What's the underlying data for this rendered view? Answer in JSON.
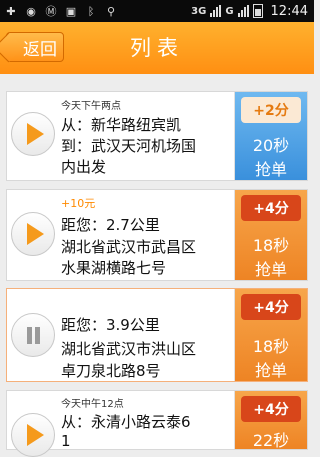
{
  "status_bar": {
    "icons": [
      "add-icon",
      "location-icon",
      "app-icon-m",
      "app-icon-square",
      "bluetooth-icon",
      "usb-icon"
    ],
    "network_1": "3G",
    "network_2": "G",
    "time": "12:44"
  },
  "header": {
    "back_label": "返回",
    "title": "列表"
  },
  "items": [
    {
      "top_text": "今天下午两点",
      "bonus_text": "",
      "lines": [
        "从：新华路纽宾凯",
        "到：武汉天河机场国",
        "内出发"
      ],
      "badge": "+2分",
      "seconds": "20秒",
      "action": "抢单",
      "style": "blue",
      "state": "play"
    },
    {
      "top_text": "",
      "bonus_text": "+10元",
      "lines": [
        "距您：2.7公里",
        "湖北省武汉市武昌区",
        "水果湖横路七号"
      ],
      "badge": "+4分",
      "seconds": "18秒",
      "action": "抢单",
      "style": "orange",
      "state": "play"
    },
    {
      "top_text": "",
      "bonus_text": "",
      "lines": [
        "距您：3.9公里",
        "湖北省武汉市洪山区",
        "卓刀泉北路8号"
      ],
      "badge": "+4分",
      "seconds": "18秒",
      "action": "抢单",
      "style": "orange",
      "state": "pause"
    },
    {
      "top_text": "今天中午12点",
      "bonus_text": "",
      "lines": [
        "从：永清小路云泰6",
        "1"
      ],
      "badge": "+4分",
      "seconds": "22秒",
      "action": "",
      "style": "orange",
      "state": "play"
    }
  ],
  "colors": {
    "header": "#ff9a1c",
    "accent_orange": "#ff8a00",
    "blue_panel": "#4a9ee2",
    "orange_panel": "#f19235"
  }
}
